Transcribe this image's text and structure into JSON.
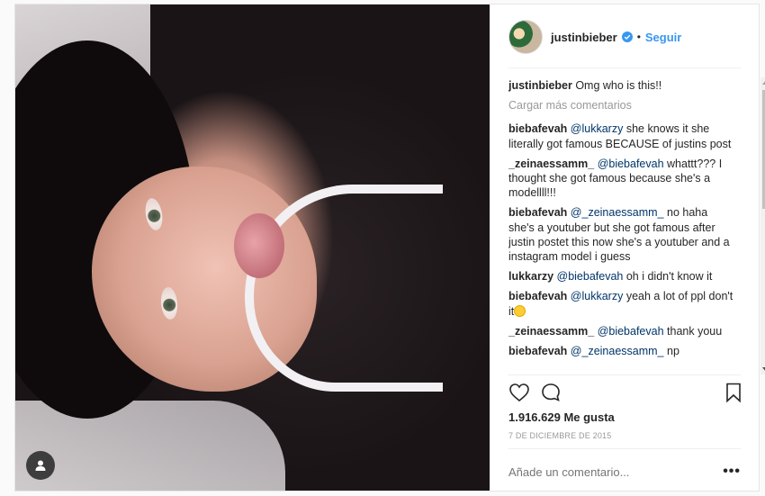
{
  "post": {
    "username": "justinbieber",
    "follow_label": "Seguir",
    "separator": "•",
    "caption": {
      "author": "justinbieber",
      "text": "Omg who is this!!"
    },
    "load_more": "Cargar más comentarios",
    "comments": [
      {
        "author": "biebafevah",
        "mention": "@lukkarzy",
        "text": " she knows it she literally got famous BECAUSE of justins post"
      },
      {
        "author": "_zeinaessamm_",
        "mention": "@biebafevah",
        "text": " whattt??? I thought she got famous because she's a modellll!!!"
      },
      {
        "author": "biebafevah",
        "mention": "@_zeinaessamm_",
        "text": " no haha she's a youtuber but she got famous after justin postet this now she's a youtuber and a instagram model i guess"
      },
      {
        "author": "lukkarzy",
        "mention": "@biebafevah",
        "text": " oh i didn't know it"
      },
      {
        "author": "biebafevah",
        "mention": "@lukkarzy",
        "text": " yeah a lot of ppl don't it"
      },
      {
        "author": "_zeinaessamm_",
        "mention": "@biebafevah",
        "text": " thank youu"
      },
      {
        "author": "biebafevah",
        "mention": "@_zeinaessamm_",
        "text": " np"
      }
    ],
    "likes": "1.916.629 Me gusta",
    "date": "7 DE DICIEMBRE DE 2015",
    "comment_placeholder": "Añade un comentario...",
    "more_label": "•••",
    "icons": {
      "like": "heart-icon",
      "comment": "comment-bubble-icon",
      "save": "bookmark-icon",
      "verified": "verified-badge-icon",
      "user_tag": "user-tag-icon"
    },
    "colors": {
      "accent": "#3897f0",
      "verified": "#3897f0",
      "muted": "#999999",
      "text": "#262626"
    }
  }
}
